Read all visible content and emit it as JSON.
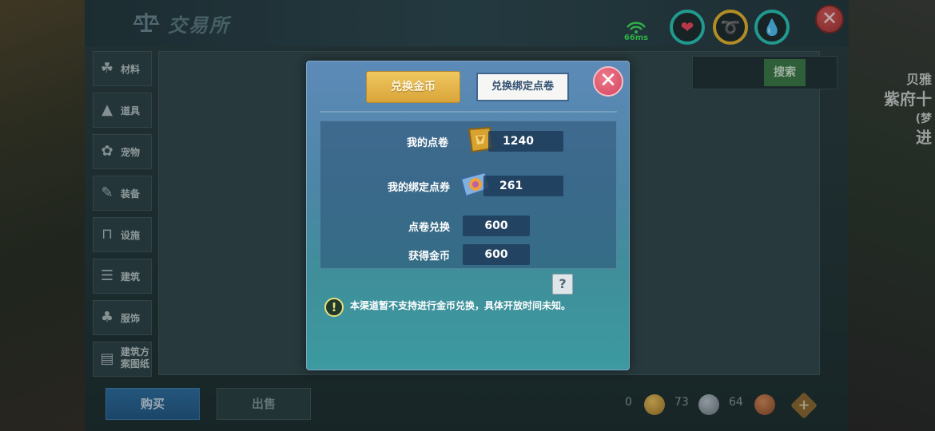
{
  "header": {
    "title": "交易所",
    "ping": "66ms"
  },
  "sidebar": {
    "items": [
      {
        "label": "材料"
      },
      {
        "label": "道具"
      },
      {
        "label": "宠物"
      },
      {
        "label": "装备"
      },
      {
        "label": "设施"
      },
      {
        "label": "建筑"
      },
      {
        "label": "服饰"
      },
      {
        "label": "建筑方案图纸"
      }
    ]
  },
  "search": {
    "button_label": "搜索"
  },
  "bottom": {
    "buy_label": "购买",
    "sell_label": "出售",
    "currencies": [
      {
        "amount": "0",
        "color": "#c49a3c"
      },
      {
        "amount": "73",
        "color": "#8a9aa4"
      },
      {
        "amount": "64",
        "color": "#a86a44"
      }
    ]
  },
  "background_text": {
    "line1": "贝雅",
    "line2": "紫府十",
    "line3": "(梦",
    "line4": "进"
  },
  "modal": {
    "tabs": {
      "active": "兑换金币",
      "inactive": "兑换绑定点卷"
    },
    "my_points_label": "我的点卷",
    "my_points_value": "1240",
    "my_bound_label": "我的绑定点券",
    "my_bound_value": "261",
    "exchange_label": "点卷兑换",
    "exchange_value": "600",
    "gain_label": "获得金币",
    "gain_value": "600",
    "help_symbol": "?",
    "notice": "本渠道暂不支持进行金币兑换，具体开放时间未知。"
  },
  "colors": {
    "accent_gold": "#e6b84c",
    "modal_close": "#d85068",
    "ping_green": "#3ce05c"
  }
}
